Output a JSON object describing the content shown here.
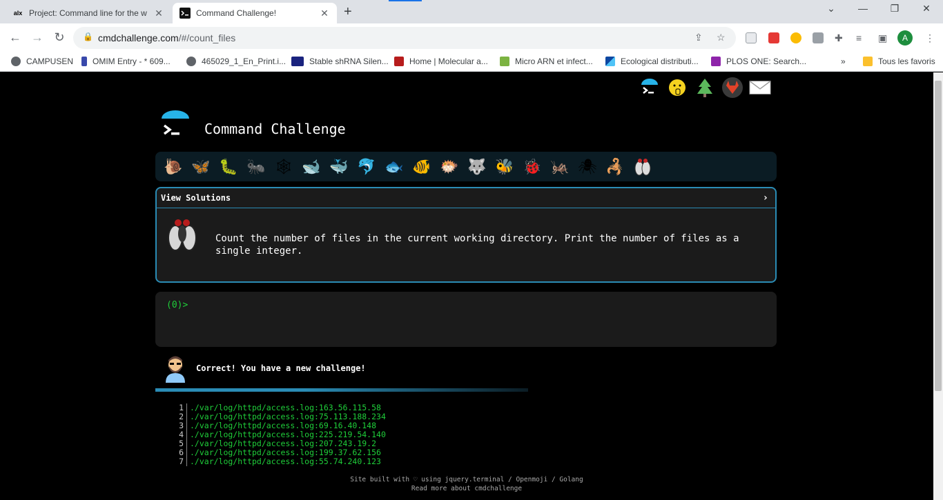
{
  "browser": {
    "tabs": [
      {
        "title": "Project: Command line for the w",
        "favicon": "alx",
        "active": false
      },
      {
        "title": "Command Challenge!",
        "favicon": "terminal-icon",
        "active": true
      }
    ],
    "url_host": "cmdchallenge.com",
    "url_path": "/#/count_files",
    "profile_initial": "A",
    "bookmarks": [
      {
        "label": "CAMPUSEN",
        "icon": "globe-icon"
      },
      {
        "label": "OMIM Entry - * 609...",
        "icon": "dna-icon"
      },
      {
        "label": "465029_1_En_Print.i...",
        "icon": "globe-icon"
      },
      {
        "label": "Stable shRNA Silen...",
        "icon": "ar-icon"
      },
      {
        "label": "Home | Molecular a...",
        "icon": "flask-icon"
      },
      {
        "label": "Micro ARN et infect...",
        "icon": "leaf-icon"
      },
      {
        "label": "Ecological distributi...",
        "icon": "triangle-icon"
      },
      {
        "label": "PLOS ONE: Search...",
        "icon": "plos-icon"
      }
    ],
    "all_bookmarks_label": "Tous les favoris"
  },
  "page": {
    "site_title": "Command Challenge",
    "top_icons": [
      "terminal-icon",
      "hint-icon",
      "tree-icon",
      "gitlab-icon",
      "mail-icon"
    ],
    "challenge_emojis": [
      "snail",
      "butterfly",
      "caterpillar",
      "ant",
      "spider-web",
      "whale",
      "whale-2",
      "dolphin",
      "fish",
      "tropical-fish",
      "blowfish",
      "wolf",
      "bee",
      "ladybug",
      "cricket",
      "spider",
      "scorpion",
      "fly"
    ],
    "view_solutions_label": "View Solutions",
    "challenge_description": "Count the number of files in the current working directory. Print the number of files as a single integer.",
    "prompt": "(0)>",
    "feedback_message": "Correct! You have a new challenge!",
    "output_lines": [
      {
        "n": "1",
        "text": "./var/log/httpd/access.log:163.56.115.58"
      },
      {
        "n": "2",
        "text": "./var/log/httpd/access.log:75.113.188.234"
      },
      {
        "n": "3",
        "text": "./var/log/httpd/access.log:69.16.40.148"
      },
      {
        "n": "4",
        "text": "./var/log/httpd/access.log:225.219.54.140"
      },
      {
        "n": "5",
        "text": "./var/log/httpd/access.log:207.243.19.2"
      },
      {
        "n": "6",
        "text": "./var/log/httpd/access.log:199.37.62.156"
      },
      {
        "n": "7",
        "text": "./var/log/httpd/access.log:55.74.240.123"
      }
    ],
    "footer_line1": "Site built with ♡ using jquery.terminal / Openmoji / Golang",
    "footer_line2": "Read more about cmdchallenge"
  },
  "colors": {
    "accent": "#2a8cb5",
    "terminal_green": "#1fcf3a",
    "panel": "#1b1b1b",
    "emoji_bar": "#0b1c24"
  }
}
